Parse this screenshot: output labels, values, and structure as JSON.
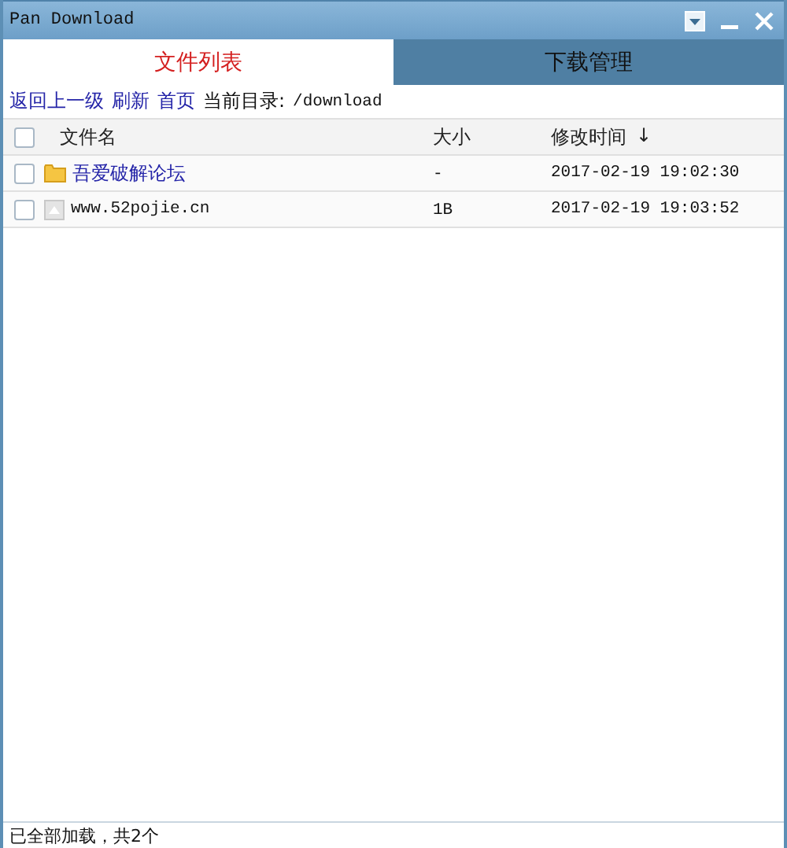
{
  "window": {
    "title": "Pan Download"
  },
  "tabs": [
    {
      "label": "文件列表",
      "selected": true
    },
    {
      "label": "下载管理",
      "selected": false
    }
  ],
  "toolbar": {
    "links": [
      "返回上一级",
      "刷新",
      "首页"
    ],
    "path_label": "当前目录:",
    "path": "/download"
  },
  "table": {
    "select_all": {
      "checked": false
    },
    "columns": [
      {
        "label": "文件名"
      },
      {
        "label": "大小"
      },
      {
        "label": "修改时间",
        "sort": "↓"
      }
    ],
    "rows": [
      {
        "kind": "folder",
        "checked": false,
        "name": "吾爱破解论坛",
        "size": "-",
        "modified": "2017-02-19 19:02:30"
      },
      {
        "kind": "file",
        "checked": false,
        "name": "www.52pojie.cn",
        "size": "1B",
        "modified": "2017-02-19 19:03:52"
      }
    ]
  },
  "status_bar": "已全部加载，共2个"
}
